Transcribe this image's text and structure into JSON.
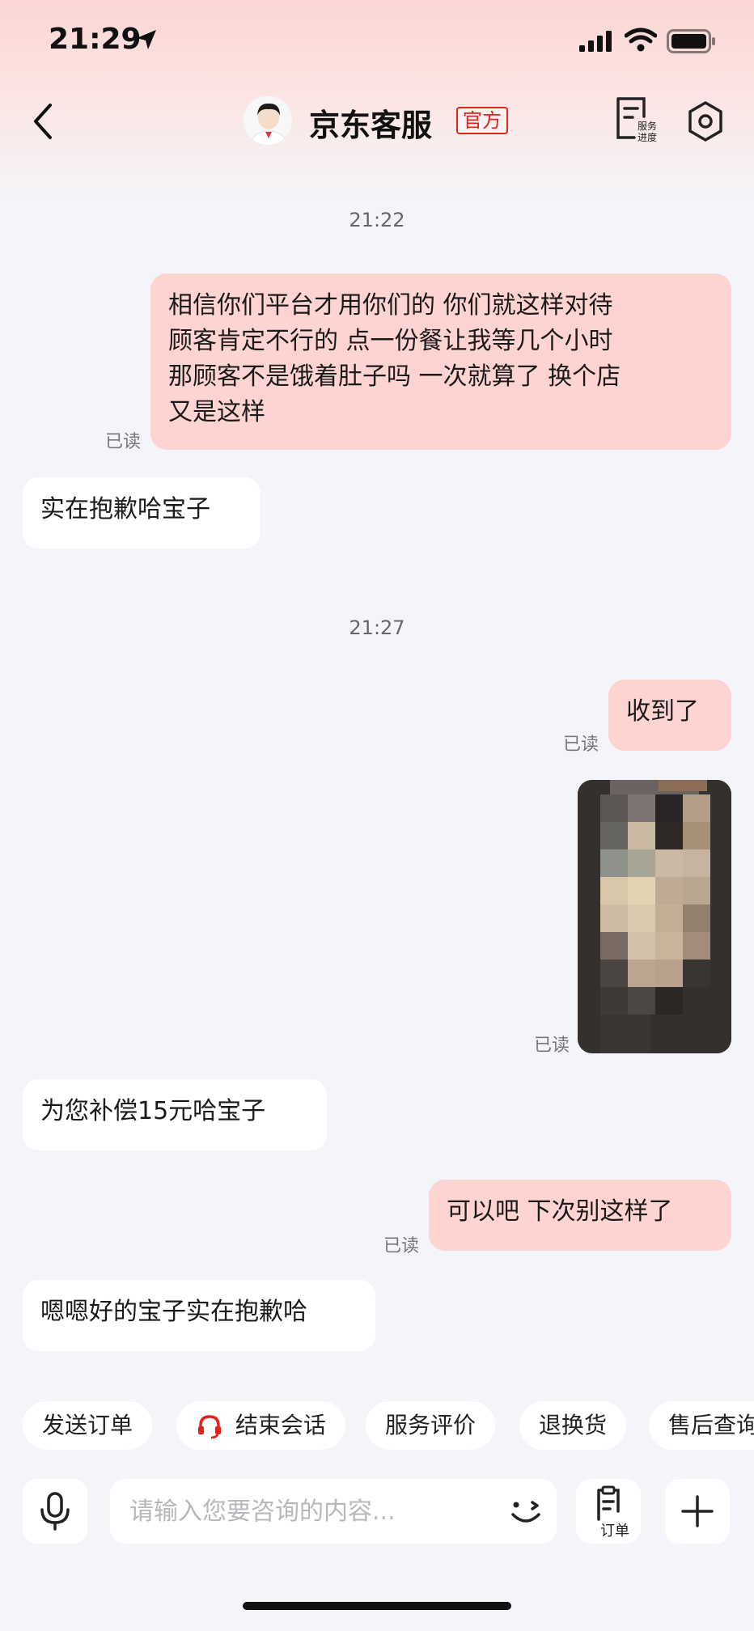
{
  "status_bar": {
    "time": "21:29"
  },
  "header": {
    "title": "京东客服",
    "badge": "官方",
    "progress_label": "服务进度"
  },
  "messages": {
    "ts1": "21:22",
    "m1": "相信你们平台才用你们的 你们就这样对待\n顾客肯定不行的 点一份餐让我等几个小时\n那顾客不是饿着肚子吗 一次就算了 换个店\n又是这样",
    "m1_status": "已读",
    "m2": "实在抱歉哈宝子",
    "ts2": "21:27",
    "m3": "收到了",
    "m3_status": "已读",
    "m4_status": "已读",
    "m5": "为您补偿15元哈宝子",
    "m6": "可以吧 下次别这样了",
    "m6_status": "已读",
    "m7": "嗯嗯好的宝子实在抱歉哈"
  },
  "quick_actions": [
    "发送订单",
    "结束会话",
    "服务评价",
    "退换货",
    "售后查询"
  ],
  "input": {
    "placeholder": "请输入您要咨询的内容...",
    "order_label": "订单"
  },
  "colors": {
    "accent": "#e2231a",
    "my_bubble": "#fdd4d1",
    "background": "#f4f5f9"
  }
}
